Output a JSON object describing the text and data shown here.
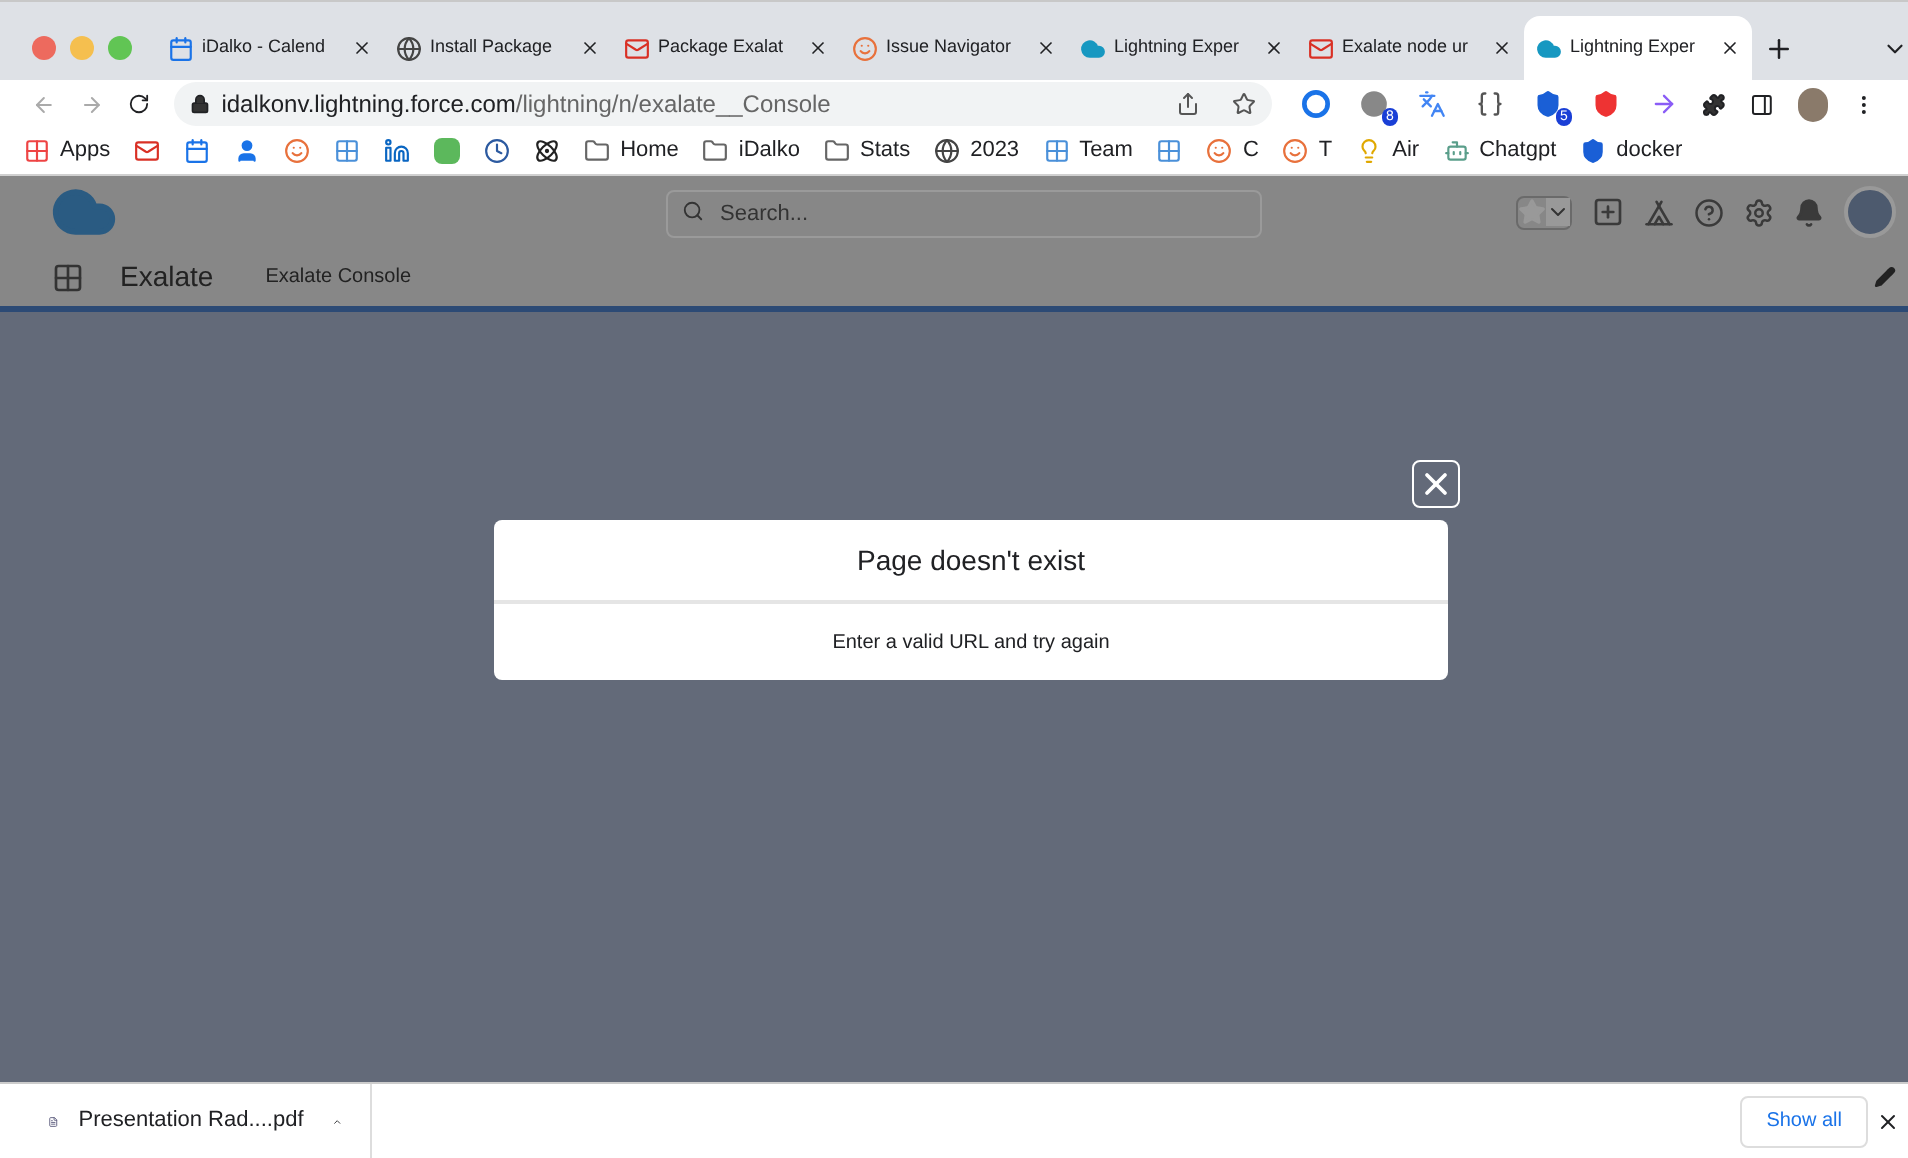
{
  "browser": {
    "tabs": [
      {
        "title": "iDalko - Calend",
        "kind": "calendar",
        "selected": false
      },
      {
        "title": "Install Package",
        "kind": "globe",
        "selected": false
      },
      {
        "title": "Package Exalat",
        "kind": "mail",
        "selected": false
      },
      {
        "title": "Issue Navigator",
        "kind": "smiley",
        "selected": false
      },
      {
        "title": "Lightning Exper",
        "kind": "cloud",
        "selected": false
      },
      {
        "title": "Exalate node ur",
        "kind": "mail",
        "selected": false
      },
      {
        "title": "Lightning Exper",
        "kind": "cloud",
        "selected": true
      }
    ],
    "address": {
      "host": "idalkonv.lightning.force.com",
      "path": "/lightning/n/exalate__Console"
    },
    "extensions": [
      {
        "kind": "ring"
      },
      {
        "kind": "gray",
        "badge": "8"
      },
      {
        "kind": "translate"
      },
      {
        "kind": "brackets"
      },
      {
        "kind": "shield",
        "badge": "5"
      },
      {
        "kind": "red"
      },
      {
        "kind": "arrow"
      }
    ],
    "bookmarks": [
      {
        "kind": "apps",
        "label": "Apps"
      },
      {
        "kind": "mail"
      },
      {
        "kind": "calendar"
      },
      {
        "kind": "person"
      },
      {
        "kind": "smiley"
      },
      {
        "kind": "grid"
      },
      {
        "kind": "linkedin"
      },
      {
        "kind": "pd"
      },
      {
        "kind": "clock"
      },
      {
        "kind": "atom"
      },
      {
        "kind": "folder",
        "label": "Home"
      },
      {
        "kind": "folder",
        "label": "iDalko"
      },
      {
        "kind": "folder",
        "label": "Stats"
      },
      {
        "kind": "globe",
        "label": "2023"
      },
      {
        "kind": "grid",
        "label": "Team"
      },
      {
        "kind": "grid"
      },
      {
        "kind": "smiley",
        "label": "C"
      },
      {
        "kind": "smiley",
        "label": "T"
      },
      {
        "kind": "lamp",
        "label": "Air"
      },
      {
        "kind": "gpt",
        "label": "Chatgpt"
      },
      {
        "kind": "shield",
        "label": "docker"
      }
    ]
  },
  "salesforce": {
    "search": {
      "placeholder": "Search..."
    },
    "app_name": "Exalate",
    "nav_items": [
      {
        "label": "Exalate Console"
      }
    ]
  },
  "dialog": {
    "title": "Page doesn't exist",
    "message": "Enter a valid URL and try again"
  },
  "downloads": {
    "file": "Presentation Rad....pdf",
    "show_all": "Show all"
  }
}
